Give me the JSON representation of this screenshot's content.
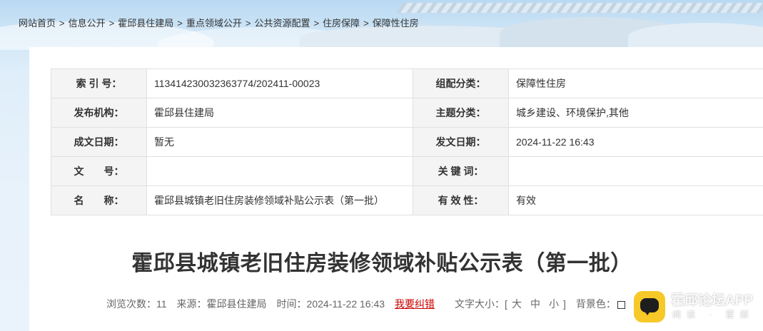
{
  "breadcrumb": [
    {
      "label": "网站首页"
    },
    {
      "label": "信息公开"
    },
    {
      "label": "霍邱县住建局"
    },
    {
      "label": "重点领域公开"
    },
    {
      "label": "公共资源配置"
    },
    {
      "label": "住房保障"
    },
    {
      "label": "保障性住房"
    }
  ],
  "breadcrumb_separator": ">",
  "meta": {
    "index_label": "索 引 号：",
    "index_value": "113414230032363774/202411-00023",
    "category_label": "组配分类：",
    "category_value": "保障性住房",
    "publisher_label": "发布机构：",
    "publisher_value": "霍邱县住建局",
    "topic_label": "主题分类：",
    "topic_value": "城乡建设、环境保护,其他",
    "created_label": "成文日期：",
    "created_value": "暂无",
    "issued_label": "发文日期：",
    "issued_value": "2024-11-22 16:43",
    "docno_label": "文　　号：",
    "docno_value": "",
    "keywords_label": "关 键 词：",
    "keywords_value": "",
    "name_label": "名　　称：",
    "name_value": "霍邱县城镇老旧住房装修领域补贴公示表（第一批）",
    "validity_label": "有 效 性：",
    "validity_value": "有效"
  },
  "article": {
    "title": "霍邱县城镇老旧住房装修领域补贴公示表（第一批）"
  },
  "info_bar": {
    "views_label": "浏览次数：",
    "views_value": "11",
    "source_label": "来源：",
    "source_value": "霍邱县住建局",
    "time_label": "时间：",
    "time_value": "2024-11-22 16:43",
    "correction_link": "我要纠错",
    "font_size_label": "文字大小：[",
    "font_large": "大",
    "font_medium": "中",
    "font_small": "小",
    "font_size_close": "]",
    "background_label": "背景色："
  },
  "app_badge": {
    "name": "霍邱论坛APP",
    "sub": "阅读 · 霍邱"
  },
  "colors": {
    "link_red": "#cc0000",
    "label_bg": "#f4f4f4",
    "border": "#e0e0e0",
    "badge_yellow": "#f6c928"
  }
}
